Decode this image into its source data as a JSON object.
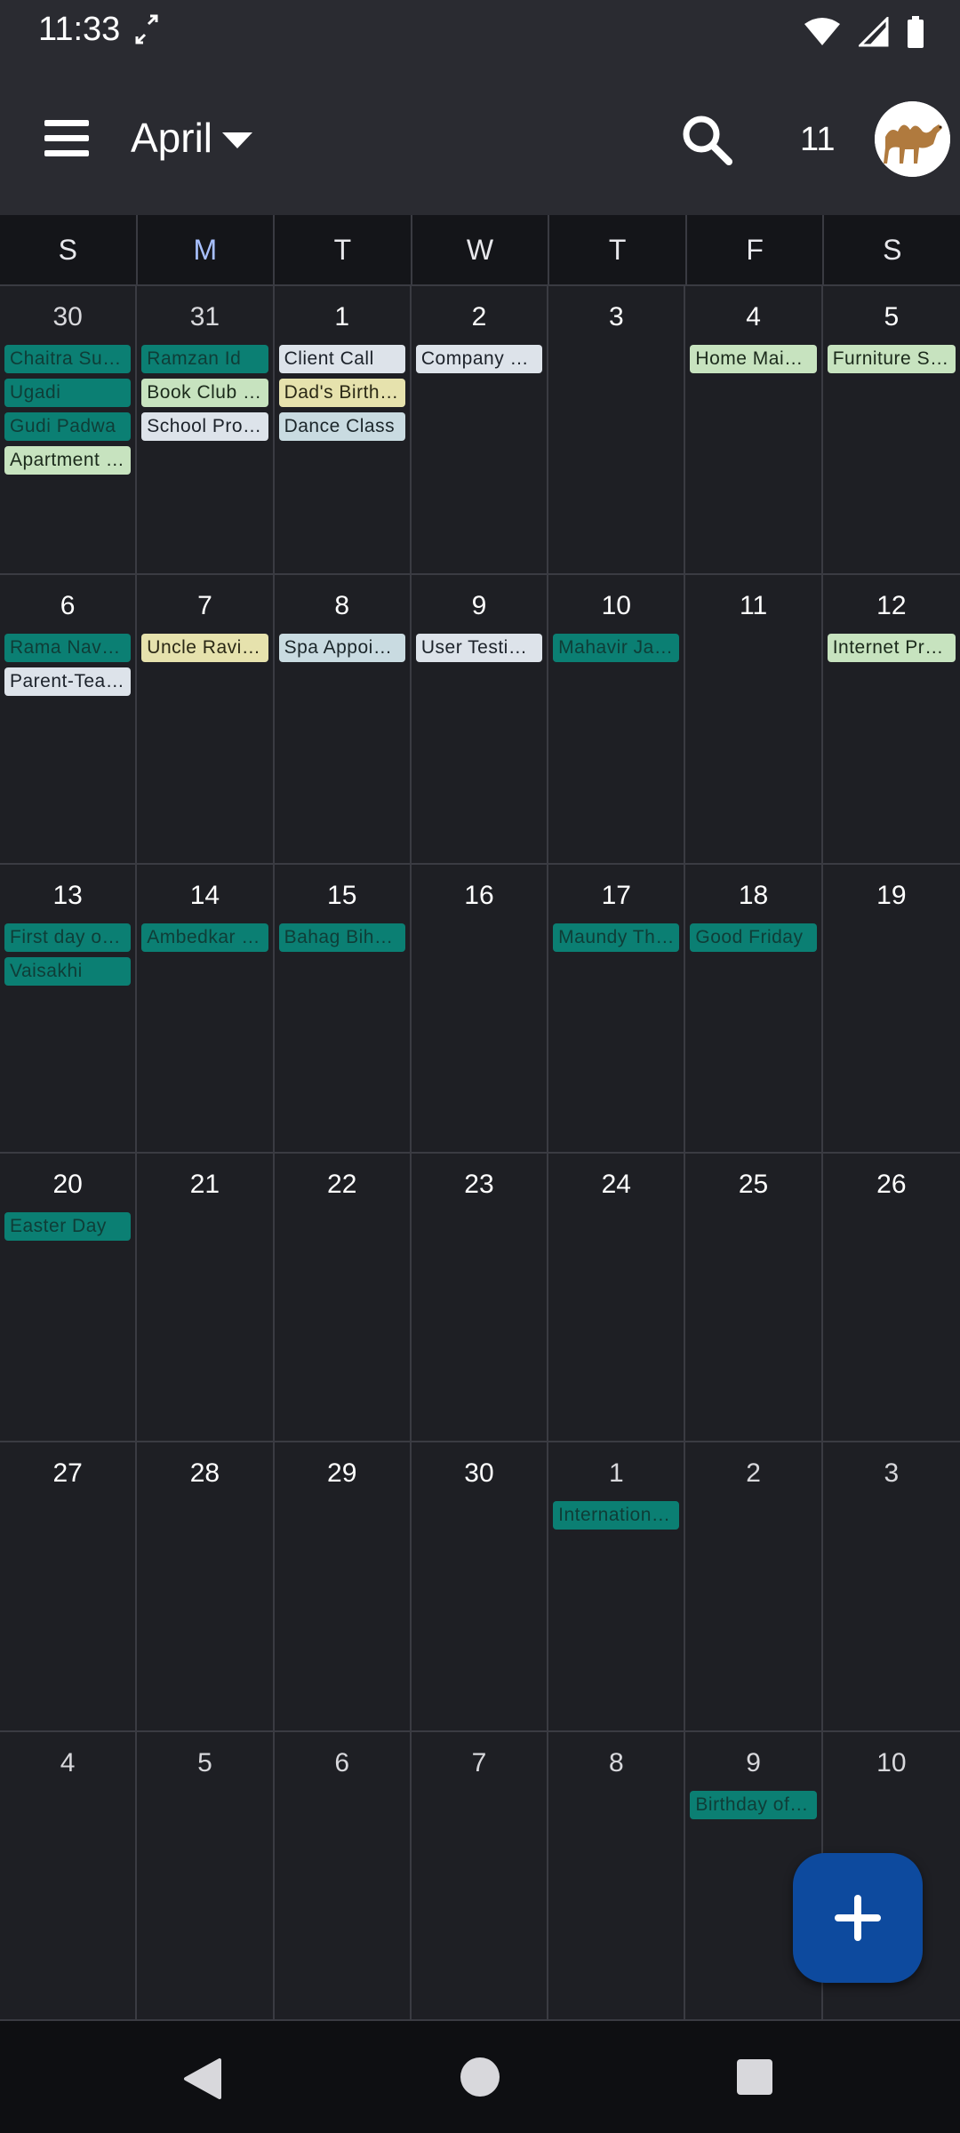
{
  "status": {
    "time": "11:33"
  },
  "appbar": {
    "month": "April",
    "today": "11"
  },
  "weekdays": [
    "S",
    "M",
    "T",
    "W",
    "T",
    "F",
    "S"
  ],
  "colors": {
    "teal": "#0b7f73",
    "green": "#c7e3bf",
    "blue": "#dde3ea",
    "yellow": "#e6e2ad",
    "accent": "#0d4a9e",
    "current_day": "#a8c0ff"
  },
  "weeks": [
    [
      {
        "day": "30",
        "events": [
          {
            "t": "Chaitra Su…",
            "c": "teal"
          },
          {
            "t": "Ugadi",
            "c": "teal"
          },
          {
            "t": "Gudi Padwa",
            "c": "teal"
          },
          {
            "t": "Apartment …",
            "c": "green"
          }
        ]
      },
      {
        "day": "31",
        "events": [
          {
            "t": "Ramzan Id",
            "c": "teal"
          },
          {
            "t": "Book Club …",
            "c": "green"
          },
          {
            "t": "School Pro…",
            "c": "blue"
          }
        ]
      },
      {
        "day": "1",
        "events": [
          {
            "t": "Client Call",
            "c": "blue"
          },
          {
            "t": "Dad's Birth…",
            "c": "yellow"
          },
          {
            "t": "Dance Class",
            "c": "sky"
          }
        ]
      },
      {
        "day": "2",
        "events": [
          {
            "t": "Company …",
            "c": "blue"
          }
        ]
      },
      {
        "day": "3",
        "events": []
      },
      {
        "day": "4",
        "events": [
          {
            "t": "Home Main…",
            "c": "green"
          }
        ]
      },
      {
        "day": "5",
        "events": [
          {
            "t": "Furniture S…",
            "c": "green"
          }
        ]
      }
    ],
    [
      {
        "day": "6",
        "events": [
          {
            "t": "Rama Nava…",
            "c": "teal"
          },
          {
            "t": "Parent-Tea…",
            "c": "blue"
          }
        ]
      },
      {
        "day": "7",
        "events": [
          {
            "t": "Uncle Ravi'…",
            "c": "yellow"
          }
        ]
      },
      {
        "day": "8",
        "events": [
          {
            "t": "Spa Appoi…",
            "c": "sky"
          }
        ]
      },
      {
        "day": "9",
        "events": [
          {
            "t": "User Testi…",
            "c": "blue"
          }
        ]
      },
      {
        "day": "10",
        "events": [
          {
            "t": "Mahavir Ja…",
            "c": "teal"
          }
        ]
      },
      {
        "day": "11",
        "events": []
      },
      {
        "day": "12",
        "events": [
          {
            "t": "Internet Pr…",
            "c": "green"
          }
        ]
      }
    ],
    [
      {
        "day": "13",
        "events": [
          {
            "t": "First day of…",
            "c": "teal"
          },
          {
            "t": "Vaisakhi",
            "c": "teal"
          }
        ]
      },
      {
        "day": "14",
        "events": [
          {
            "t": "Ambedkar …",
            "c": "teal"
          }
        ]
      },
      {
        "day": "15",
        "events": [
          {
            "t": "Bahag Bih…",
            "c": "teal"
          }
        ]
      },
      {
        "day": "16",
        "events": []
      },
      {
        "day": "17",
        "events": [
          {
            "t": "Maundy Th…",
            "c": "teal"
          }
        ]
      },
      {
        "day": "18",
        "events": [
          {
            "t": "Good Friday",
            "c": "teal"
          }
        ]
      },
      {
        "day": "19",
        "events": []
      }
    ],
    [
      {
        "day": "20",
        "events": [
          {
            "t": "Easter Day",
            "c": "teal"
          }
        ]
      },
      {
        "day": "21",
        "events": []
      },
      {
        "day": "22",
        "events": []
      },
      {
        "day": "23",
        "events": []
      },
      {
        "day": "24",
        "events": []
      },
      {
        "day": "25",
        "events": []
      },
      {
        "day": "26",
        "events": []
      }
    ],
    [
      {
        "day": "27",
        "events": []
      },
      {
        "day": "28",
        "events": []
      },
      {
        "day": "29",
        "events": []
      },
      {
        "day": "30",
        "events": []
      },
      {
        "day": "1",
        "events": [
          {
            "t": "Internation…",
            "c": "teal"
          }
        ]
      },
      {
        "day": "2",
        "events": []
      },
      {
        "day": "3",
        "events": []
      }
    ],
    [
      {
        "day": "4",
        "events": []
      },
      {
        "day": "5",
        "events": []
      },
      {
        "day": "6",
        "events": []
      },
      {
        "day": "7",
        "events": []
      },
      {
        "day": "8",
        "events": []
      },
      {
        "day": "9",
        "events": [
          {
            "t": "Birthday of…",
            "c": "teal"
          }
        ]
      },
      {
        "day": "10",
        "events": []
      }
    ]
  ],
  "icons": {
    "menu": "menu-icon",
    "search": "search-icon",
    "fab": "add-icon",
    "back": "back-icon",
    "home": "home-icon",
    "recents": "recents-icon"
  }
}
